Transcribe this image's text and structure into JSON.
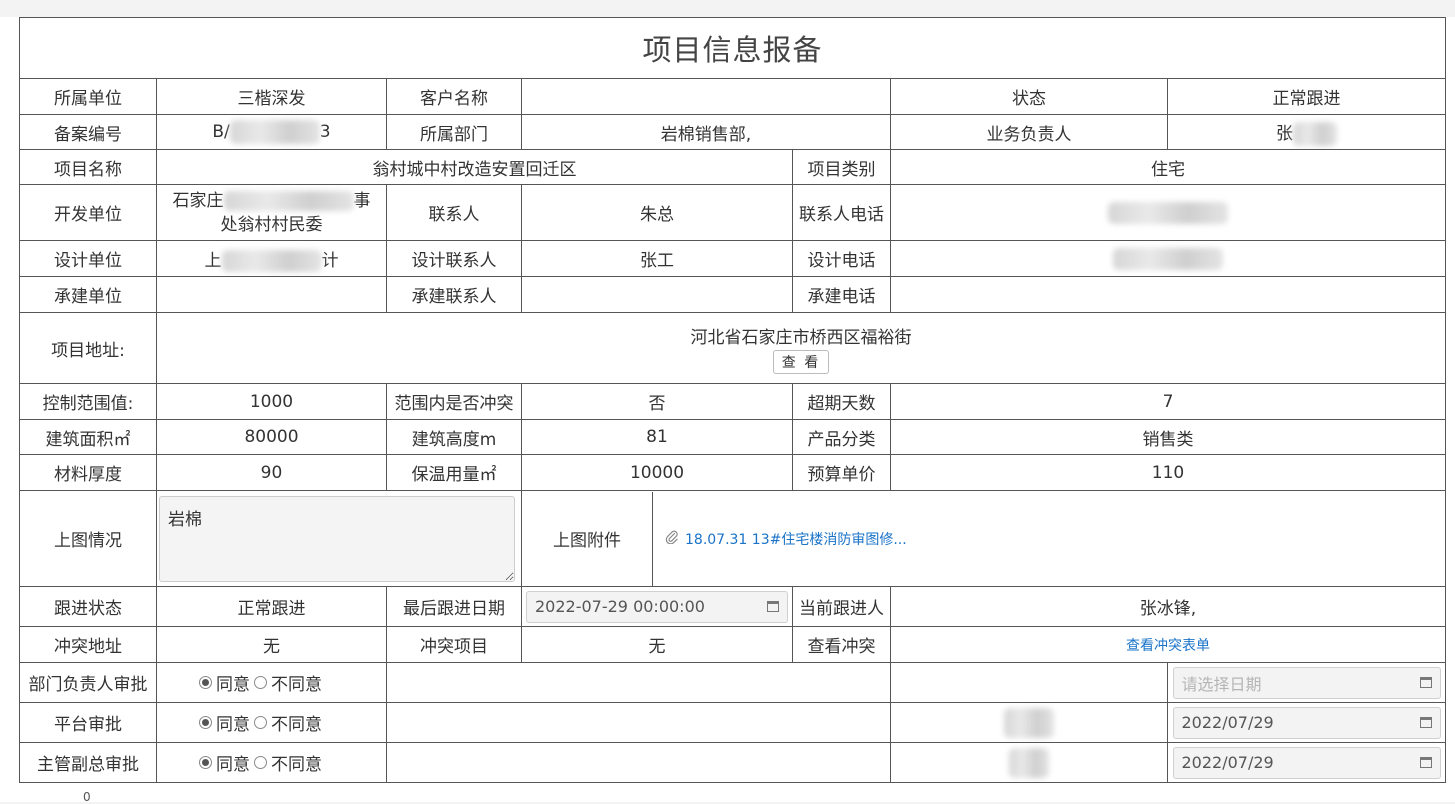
{
  "title": "项目信息报备",
  "row1": {
    "unit_label": "所属单位",
    "unit_value": "三楷深发",
    "client_label": "客户名称",
    "client_value": "",
    "status_label": "状态",
    "status_value": "正常跟进"
  },
  "row2": {
    "record_label": "备案编号",
    "record_prefix": "B/",
    "record_suffix": "3",
    "dept_label": "所属部门",
    "dept_value": "岩棉销售部,",
    "owner_label": "业务负责人",
    "owner_value": "张"
  },
  "row3": {
    "name_label": "项目名称",
    "name_value": "翁村城中村改造安置回迁区",
    "type_label": "项目类别",
    "type_value": "住宅"
  },
  "row4": {
    "dev_label": "开发单位",
    "dev_value_line1": "石家庄",
    "dev_value_line1_end": "事",
    "dev_value_line2": "处翁村村民委",
    "contact_label": "联系人",
    "contact_value": "朱总",
    "phone_label": "联系人电话"
  },
  "row5": {
    "design_label": "设计单位",
    "design_prefix": "上",
    "design_suffix": "计",
    "dcontact_label": "设计联系人",
    "dcontact_value": "张工",
    "dphone_label": "设计电话"
  },
  "row6": {
    "build_label": "承建单位",
    "build_value": "",
    "bcontact_label": "承建联系人",
    "bcontact_value": "",
    "bphone_label": "承建电话"
  },
  "row7": {
    "addr_label": "项目地址:",
    "addr_value": "河北省石家庄市桥西区福裕街",
    "view_btn": "查 看"
  },
  "row8": {
    "range_label": "控制范围值:",
    "range_value": "1000",
    "conflict_label": "范围内是否冲突",
    "conflict_value": "否",
    "overdue_label": "超期天数",
    "overdue_value": "7"
  },
  "row9": {
    "area_label": "建筑面积㎡",
    "area_value": "80000",
    "height_label": "建筑高度m",
    "height_value": "81",
    "product_label": "产品分类",
    "product_value": "销售类"
  },
  "row10": {
    "thick_label": "材料厚度",
    "thick_value": "90",
    "insul_label": "保温用量㎡",
    "insul_value": "10000",
    "price_label": "预算单价",
    "price_value": "110"
  },
  "row11": {
    "drawing_label": "上图情况",
    "drawing_value": "岩棉",
    "attach_label": "上图附件",
    "attach_link": "18.07.31 13#住宅楼消防审图修..."
  },
  "row12": {
    "follow_label": "跟进状态",
    "follow_value": "正常跟进",
    "last_label": "最后跟进日期",
    "last_value": "2022-07-29 00:00:00",
    "current_label": "当前跟进人",
    "current_value": "张冰锋,"
  },
  "row13": {
    "caddr_label": "冲突地址",
    "caddr_value": "无",
    "cproj_label": "冲突项目",
    "cproj_value": "无",
    "ccheck_label": "查看冲突",
    "ccheck_link": "查看冲突表单"
  },
  "approvals": [
    {
      "label": "部门负责人审批",
      "agree": "同意",
      "disagree": "不同意",
      "date": "请选择日期"
    },
    {
      "label": "平台审批",
      "agree": "同意",
      "disagree": "不同意",
      "date": "2022/07/29"
    },
    {
      "label": "主管副总审批",
      "agree": "同意",
      "disagree": "不同意",
      "date": "2022/07/29"
    }
  ],
  "footer_number": "0"
}
